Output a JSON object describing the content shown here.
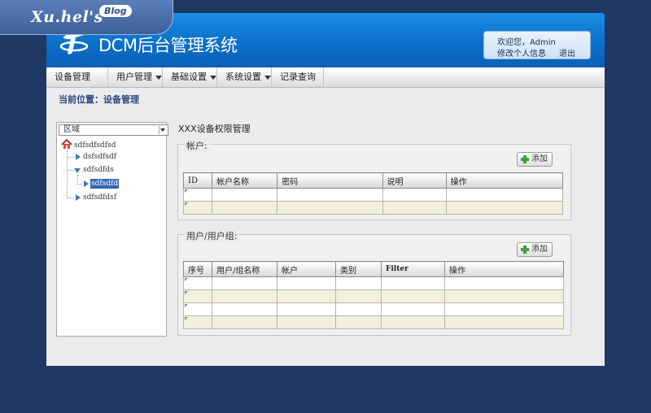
{
  "watermark": {
    "text": "Xu.hel's",
    "badge": "Blog"
  },
  "app": {
    "title": "DCM后台管理系统"
  },
  "user": {
    "greeting": "欢迎您，Admin",
    "profile_link": "修改个人信息",
    "logout_link": "退出"
  },
  "nav": {
    "items": [
      {
        "label": "设备管理",
        "dropdown": false
      },
      {
        "label": "用户管理",
        "dropdown": true
      },
      {
        "label": "基础设置",
        "dropdown": true
      },
      {
        "label": "系统设置",
        "dropdown": true
      },
      {
        "label": "记录查询",
        "dropdown": false
      }
    ]
  },
  "breadcrumb": "当前位置：设备管理",
  "sidebar": {
    "region_select": "区域",
    "tree": {
      "root": "sdfsdfsdfsd",
      "child1": "dsfsdfsdf",
      "child2": "sdfsdfds",
      "grandchild": "sdfsdfd",
      "child3": "sdfsdfdsf"
    }
  },
  "main": {
    "heading": "XXX设备权限管理",
    "accounts": {
      "legend": "帐户:",
      "add_label": "添加",
      "columns": [
        "ID",
        "帐户名称",
        "密码",
        "说明",
        "操作"
      ]
    },
    "users": {
      "legend": "用户/用户组:",
      "add_label": "添加",
      "columns": [
        "序号",
        "用户/组名称",
        "帐户",
        "类别",
        "Filter",
        "操作"
      ]
    }
  },
  "colors": {
    "header_blue": "#0b6dc8",
    "page_background": "#1f3864",
    "selected_node": "#3265b8",
    "add_icon": "#3ba33b"
  }
}
